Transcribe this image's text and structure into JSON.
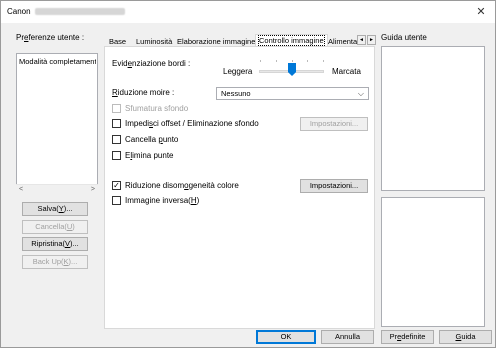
{
  "window": {
    "title": "Canon",
    "close_glyph": "✕"
  },
  "left": {
    "preferences_label_pre": "Pr",
    "preferences_label_ul": "e",
    "preferences_label_post": "ferenze utente :",
    "list_items": [
      "Modalità completamente"
    ],
    "scroll_left": "<",
    "scroll_right": ">",
    "buttons": {
      "save_pre": "Salva(",
      "save_ul": "Y",
      "save_post": ")...",
      "delete_pre": "Cancella(",
      "delete_ul": "U",
      "delete_post": ")",
      "restore_pre": "Ripristina(",
      "restore_ul": "V",
      "restore_post": ")...",
      "backup_pre": "Back Up(",
      "backup_ul": "K",
      "backup_post": ")..."
    }
  },
  "tabs": {
    "items": [
      "Base",
      "Luminosità",
      "Elaborazione immagine",
      "Controllo immagine",
      "Alimenta"
    ],
    "active": "Controllo immagine",
    "nav_left": "◄",
    "nav_right": "►"
  },
  "content": {
    "edge_label_pre": "Evid",
    "edge_label_ul": "e",
    "edge_label_post": "nziazione bordi :",
    "edge_light": "Leggera",
    "edge_strong": "Marcata",
    "moire_label_pre": "",
    "moire_label_ul": "R",
    "moire_label_post": "iduzione moire :",
    "moire_value": "Nessuno",
    "moire_chevron": "⌵",
    "blur_bg": "Sfumatura sfondo",
    "offset_pre": "Impedi",
    "offset_ul": "s",
    "offset_post": "ci offset / Eliminazione sfondo",
    "offset_settings": "Impostazioni...",
    "dot_pre": "Cancella ",
    "dot_ul": "p",
    "dot_post": "unto",
    "notch_pre": "E",
    "notch_ul": "l",
    "notch_post": "imina punte",
    "color_pre": "Riduzione disom",
    "color_ul": "o",
    "color_post": "geneità colore",
    "color_checked": "✓",
    "color_settings": "Impostazioni...",
    "inverse_pre": "Immagine inversa(",
    "inverse_ul": "H",
    "inverse_post": ")"
  },
  "guide": {
    "label": "Guida utente"
  },
  "footer": {
    "ok": "OK",
    "cancel": "Annulla",
    "defaults_pre": "Pr",
    "defaults_ul": "e",
    "defaults_post": "definite",
    "help_pre": "",
    "help_ul": "G",
    "help_post": "uida"
  }
}
